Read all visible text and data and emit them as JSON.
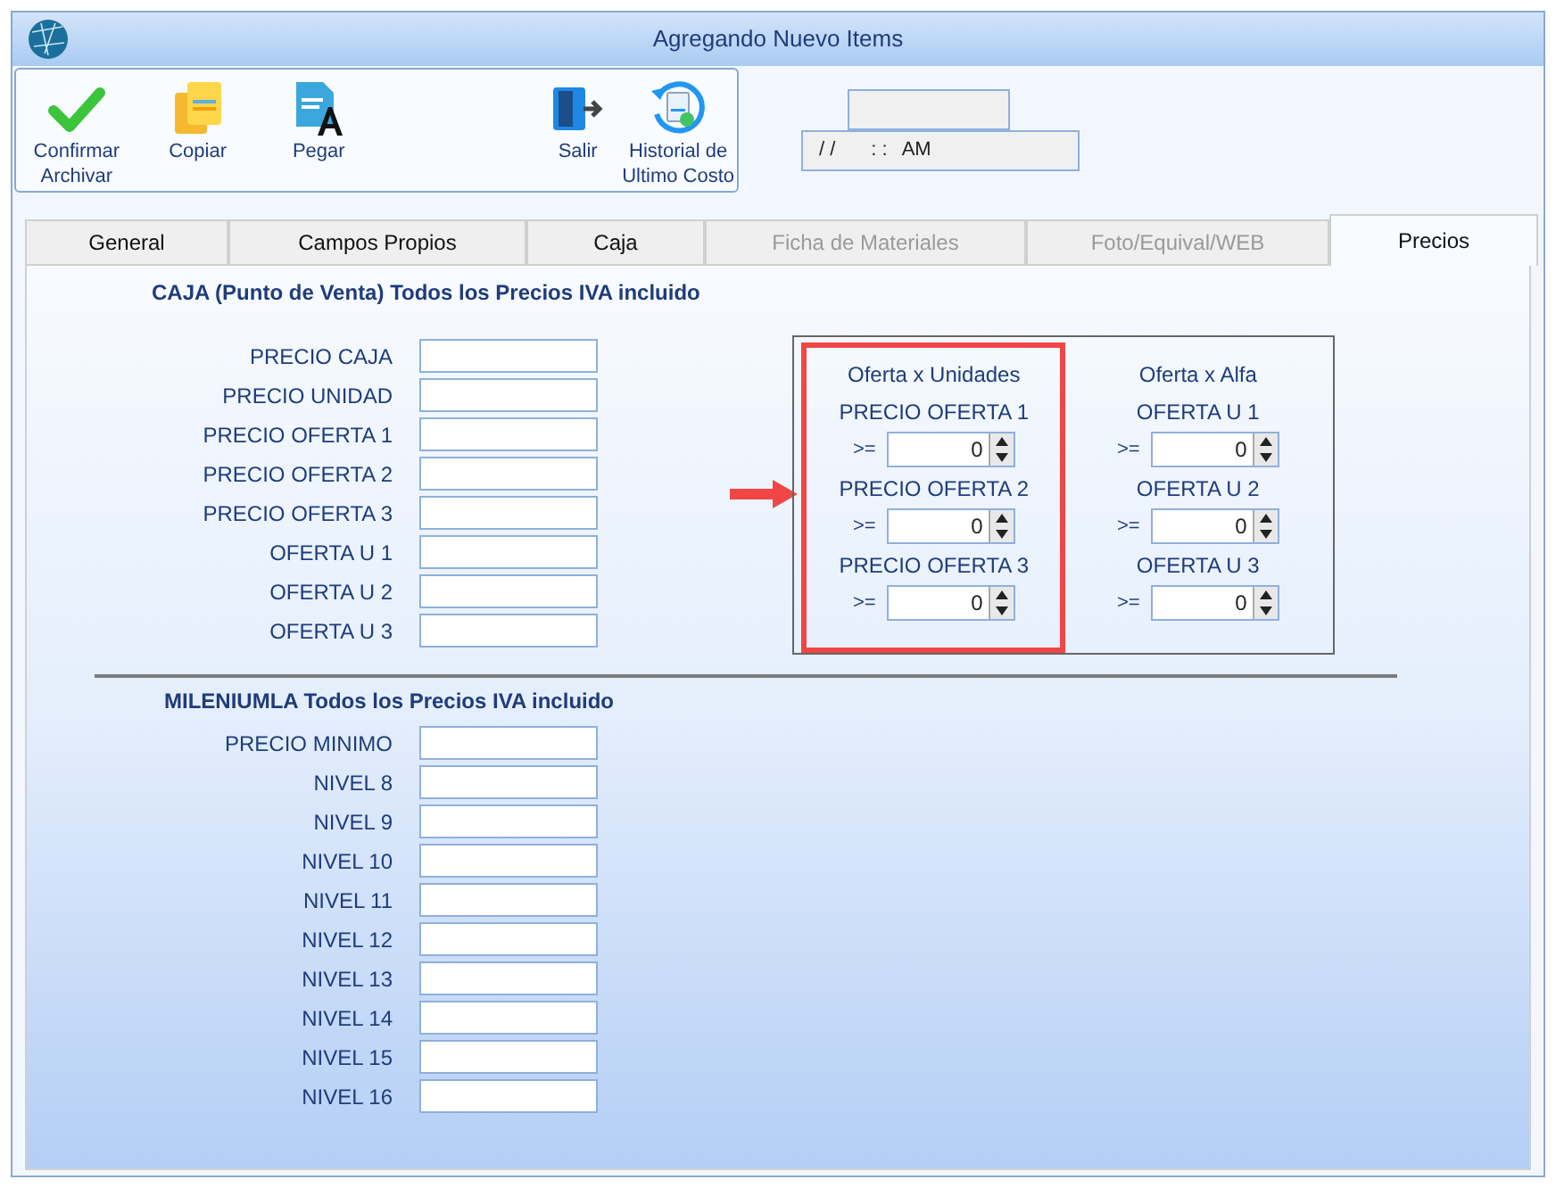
{
  "window": {
    "title": "Agregando Nuevo Items"
  },
  "toolbar": [
    {
      "kind": "check",
      "label": "Confirmar Archivar"
    },
    {
      "kind": "copy",
      "label": "Copiar"
    },
    {
      "kind": "paste",
      "label": "Pegar"
    },
    {
      "kind": "exit",
      "label": "Salir"
    },
    {
      "kind": "history",
      "label": "Historial de Ultimo Costo"
    }
  ],
  "datetime": {
    "date": "/ /",
    "time": ": :",
    "meridiem": "AM"
  },
  "tabs": [
    {
      "label": "General",
      "selected": false,
      "disabled": false
    },
    {
      "label": "Campos Propios",
      "selected": false,
      "disabled": false
    },
    {
      "label": "Caja",
      "selected": false,
      "disabled": false
    },
    {
      "label": "Ficha de Materiales",
      "selected": false,
      "disabled": true
    },
    {
      "label": "Foto/Equival/WEB",
      "selected": false,
      "disabled": true
    },
    {
      "label": "Precios",
      "selected": true,
      "disabled": false
    }
  ],
  "caja": {
    "heading": "CAJA (Punto de Venta) Todos los Precios IVA incluido",
    "fields": [
      "PRECIO CAJA",
      "PRECIO UNIDAD",
      "PRECIO OFERTA 1",
      "PRECIO OFERTA 2",
      "PRECIO OFERTA 3",
      "OFERTA U 1",
      "OFERTA U 2",
      "OFERTA U 3"
    ]
  },
  "offers": [
    {
      "title": "Oferta x Unidades",
      "highlighted": true,
      "rows": [
        {
          "label": "PRECIO OFERTA 1",
          "operator": ">=",
          "value": "0"
        },
        {
          "label": "PRECIO OFERTA 2",
          "operator": ">=",
          "value": "0"
        },
        {
          "label": "PRECIO OFERTA 3",
          "operator": ">=",
          "value": "0"
        }
      ]
    },
    {
      "title": "Oferta x Alfa",
      "highlighted": false,
      "rows": [
        {
          "label": "OFERTA U 1",
          "operator": ">=",
          "value": "0"
        },
        {
          "label": "OFERTA U 2",
          "operator": ">=",
          "value": "0"
        },
        {
          "label": "OFERTA U 3",
          "operator": ">=",
          "value": "0"
        }
      ]
    }
  ],
  "mileniumla": {
    "heading": "MILENIUMLA  Todos los Precios IVA incluido",
    "fields": [
      "PRECIO MINIMO",
      "NIVEL 8",
      "NIVEL 9",
      "NIVEL 10",
      "NIVEL 11",
      "NIVEL 12",
      "NIVEL 13",
      "NIVEL 14",
      "NIVEL 15",
      "NIVEL 16"
    ]
  }
}
